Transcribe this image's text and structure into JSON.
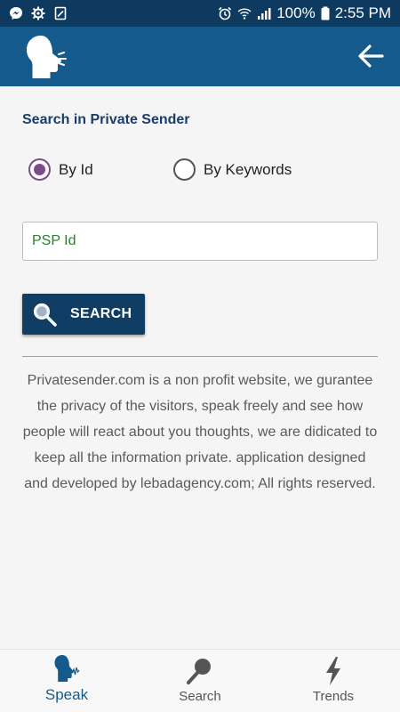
{
  "status_bar": {
    "battery": "100%",
    "time": "2:55 PM",
    "left_icons": [
      "messenger-icon",
      "settings-gear-icon",
      "clipboard-icon"
    ],
    "right_icons": [
      "alarm-icon",
      "wifi-icon",
      "signal-icon"
    ]
  },
  "app_bar": {
    "logo_icon": "speaking-head-icon",
    "back_icon": "back-arrow-icon",
    "color": "#155a8c"
  },
  "search": {
    "title": "Search in Private Sender",
    "options": [
      {
        "label": "By Id",
        "selected": true
      },
      {
        "label": "By Keywords",
        "selected": false
      }
    ],
    "input_placeholder": "PSP Id",
    "input_value": "",
    "button_label": "SEARCH"
  },
  "about_text": "Privatesender.com is a non profit website, we gurantee the privacy of the visitors, speak freely and see how people will react about you thoughts, we are didicated to keep all the information private. application designed and developed by lebadagency.com; All rights reserved.",
  "bottom_nav": [
    {
      "label": "Speak",
      "icon": "speak-icon",
      "active": true
    },
    {
      "label": "Search",
      "icon": "search-icon",
      "active": false
    },
    {
      "label": "Trends",
      "icon": "lightning-icon",
      "active": false
    }
  ],
  "colors": {
    "status_bar": "#0d3a5e",
    "primary": "#155a8c",
    "button": "#0f3d64",
    "radio_accent": "#7a4d8a",
    "input_text": "#2e7d32"
  }
}
